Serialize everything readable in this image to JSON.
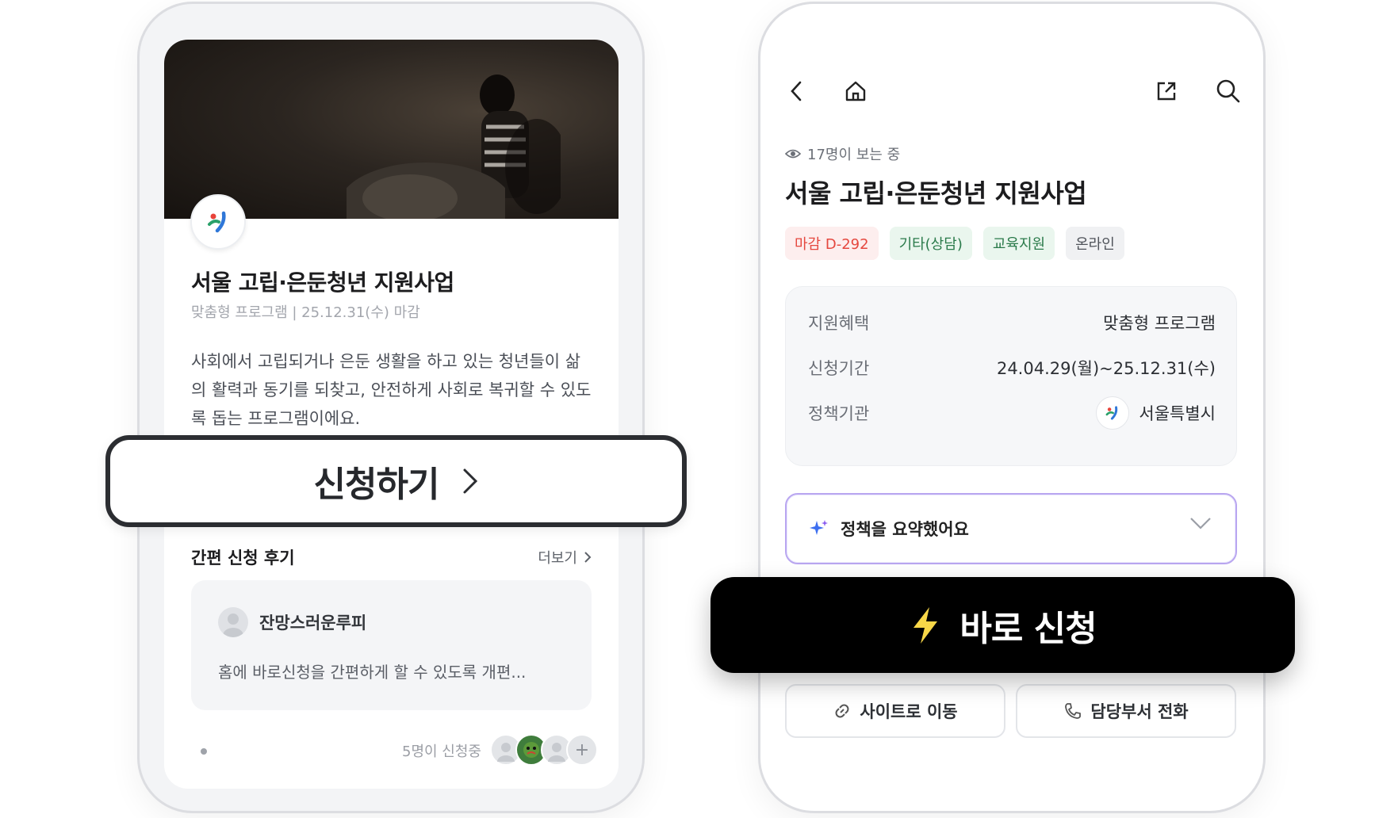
{
  "left_card": {
    "title": "서울 고립·은둔청년 지원사업",
    "subtitle": "맞춤형 프로그램 | 25.12.31(수) 마감",
    "description": "사회에서 고립되거나 은둔 생활을 하고 있는 청년들이 삶의 활력과 동기를 되찾고, 안전하게 사회로 복귀할 수 있도록 돕는 프로그램이에요.",
    "apply_label": "신청하기",
    "review_title": "간편 신청 후기",
    "more_label": "더보기",
    "reviewer_name": "잔망스러운루피",
    "review_text": "홈에 바로신청을 간편하게 할 수 있도록 개편...",
    "applying_text": "5명이 신청중",
    "more_avatar": "+"
  },
  "right_phone": {
    "viewers": "17명이 보는 중",
    "title": "서울 고립·은둔청년 지원사업",
    "tags": [
      "마감 D-292",
      "기타(상담)",
      "교육지원",
      "온라인"
    ],
    "info": [
      {
        "key": "지원혜택",
        "value": "맞춤형 프로그램"
      },
      {
        "key": "신청기간",
        "value": "24.04.29(월)~25.12.31(수)"
      },
      {
        "key": "정책기관",
        "value": "서울특별시"
      }
    ],
    "summary_label": "정책을 요약했어요",
    "direct_apply_label": "바로 신청",
    "site_button": "사이트로 이동",
    "call_button": "담당부서 전화"
  },
  "colors": {
    "deadline_red": "#e5483f",
    "lightning_yellow": "#f8d748",
    "summary_gradient": [
      "#b260f0",
      "#5b7cf5"
    ]
  },
  "icons": [
    "back-icon",
    "home-icon",
    "share-icon",
    "search-icon",
    "eye-icon",
    "sparkle-icon",
    "chevron-down-icon",
    "lightning-icon",
    "link-icon",
    "phone-icon",
    "chevron-right-icon"
  ]
}
